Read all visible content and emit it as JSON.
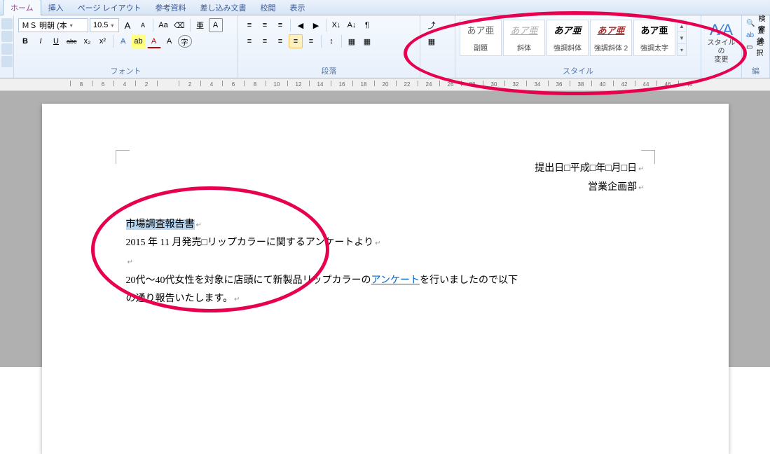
{
  "tabs": [
    "ホーム",
    "挿入",
    "ページ レイアウト",
    "参考資料",
    "差し込み文書",
    "校閲",
    "表示"
  ],
  "active_tab": 0,
  "font": {
    "name": "ＭＳ 明朝 (本",
    "size": "10.5",
    "buttons": {
      "grow": "A",
      "shrink": "A",
      "case": "Aa",
      "clear": "⌫",
      "phonetic": "亜",
      "charbox": "A",
      "bold": "B",
      "italic": "I",
      "underline": "U",
      "strike": "abc",
      "sub": "x₂",
      "super": "x²",
      "effects": "A",
      "highlight": "ab",
      "fontcolor": "A"
    },
    "label": "フォント"
  },
  "para": {
    "label": "段落",
    "buttons": {
      "bullets": "≡",
      "numbers": "≡",
      "multilevel": "≡",
      "dedent": "◀",
      "indent": "▶",
      "sort": "A↓",
      "marks": "¶",
      "alignL": "≡",
      "alignC": "≡",
      "alignR": "≡",
      "alignJ": "≡",
      "spacing": "↕",
      "shade": "▦",
      "border": "▦"
    }
  },
  "random": {
    "a": "⤴",
    "b": "A↓",
    "c": "↕",
    "d": "▦",
    "e": "▦"
  },
  "styles": {
    "label": "スタイル",
    "items": [
      {
        "sample": "あア亜",
        "label": "副題",
        "fs": "normal"
      },
      {
        "sample": "あア亜",
        "label": "斜体",
        "fs": "italic-gray-under"
      },
      {
        "sample": "あア亜",
        "label": "強調斜体",
        "fs": "italic-bold"
      },
      {
        "sample": "あア亜",
        "label": "強調斜体 2",
        "fs": "italic-bold-red-under"
      },
      {
        "sample": "あア亜",
        "label": "強調太字",
        "fs": "bold"
      }
    ]
  },
  "change": {
    "label": "スタイルの\n変更"
  },
  "edit": {
    "find": "検索",
    "replace": "置換",
    "select": "選択",
    "label": "編"
  },
  "ruler_marks": [
    "8",
    "6",
    "4",
    "2",
    "",
    "2",
    "4",
    "6",
    "8",
    "10",
    "12",
    "14",
    "16",
    "18",
    "20",
    "22",
    "24",
    "26",
    "28",
    "30",
    "32",
    "34",
    "36",
    "38",
    "40",
    "42",
    "44",
    "46",
    "48"
  ],
  "doc": {
    "date": "提出日□平成□年□月□日",
    "dept": "営業企画部",
    "title_sel": "市場調査報告書",
    "line2a": "2015 年 11 月発売□リップカラーに関するアンケートより",
    "body1a": "20代～40代女性を対象に店頭にて新製品リップカラーの",
    "body1link": "アンケート",
    "body1b": "を行いましたので以下",
    "body2": "の通り報告いたします。"
  }
}
